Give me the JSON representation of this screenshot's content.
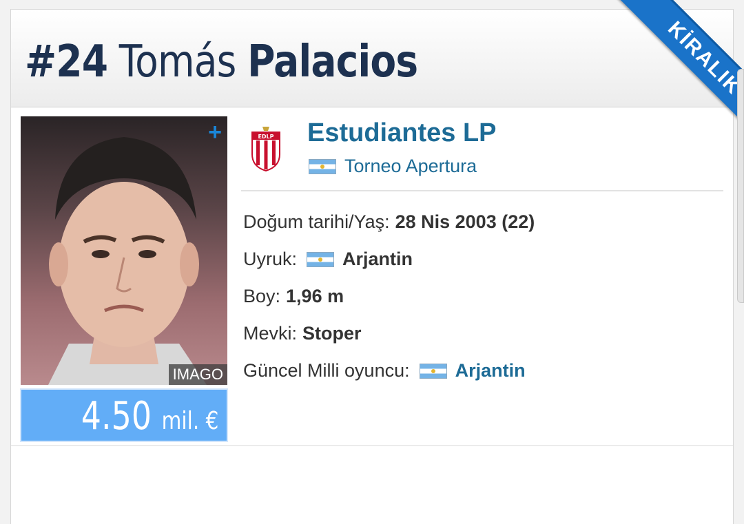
{
  "player": {
    "number": "#24",
    "first_name": "Tomás",
    "last_name": "Palacios",
    "status_ribbon": "KİRALIK",
    "photo_credit": "IMAGO",
    "photo_more_icon": "plus-icon",
    "market_value_amount": "4.50",
    "market_value_unit": "mil. €"
  },
  "club": {
    "name": "Estudiantes LP",
    "logo_text": "EDLP",
    "league_flag": "argentina-flag",
    "league": "Torneo Apertura"
  },
  "info": {
    "birth_label": "Doğum tarihi/Yaş:",
    "birth_value": "28 Nis 2003 (22)",
    "nationality_label": "Uyruk:",
    "nationality_value": "Arjantin",
    "height_label": "Boy:",
    "height_value": "1,96 m",
    "position_label": "Mevki:",
    "position_value": "Stoper",
    "national_label": "Güncel Milli oyuncu:",
    "national_value": "Arjantin"
  },
  "colors": {
    "title": "#1d3150",
    "link": "#1d6b96",
    "ribbon": "#1a73c9",
    "value_box": "#62adf7"
  }
}
